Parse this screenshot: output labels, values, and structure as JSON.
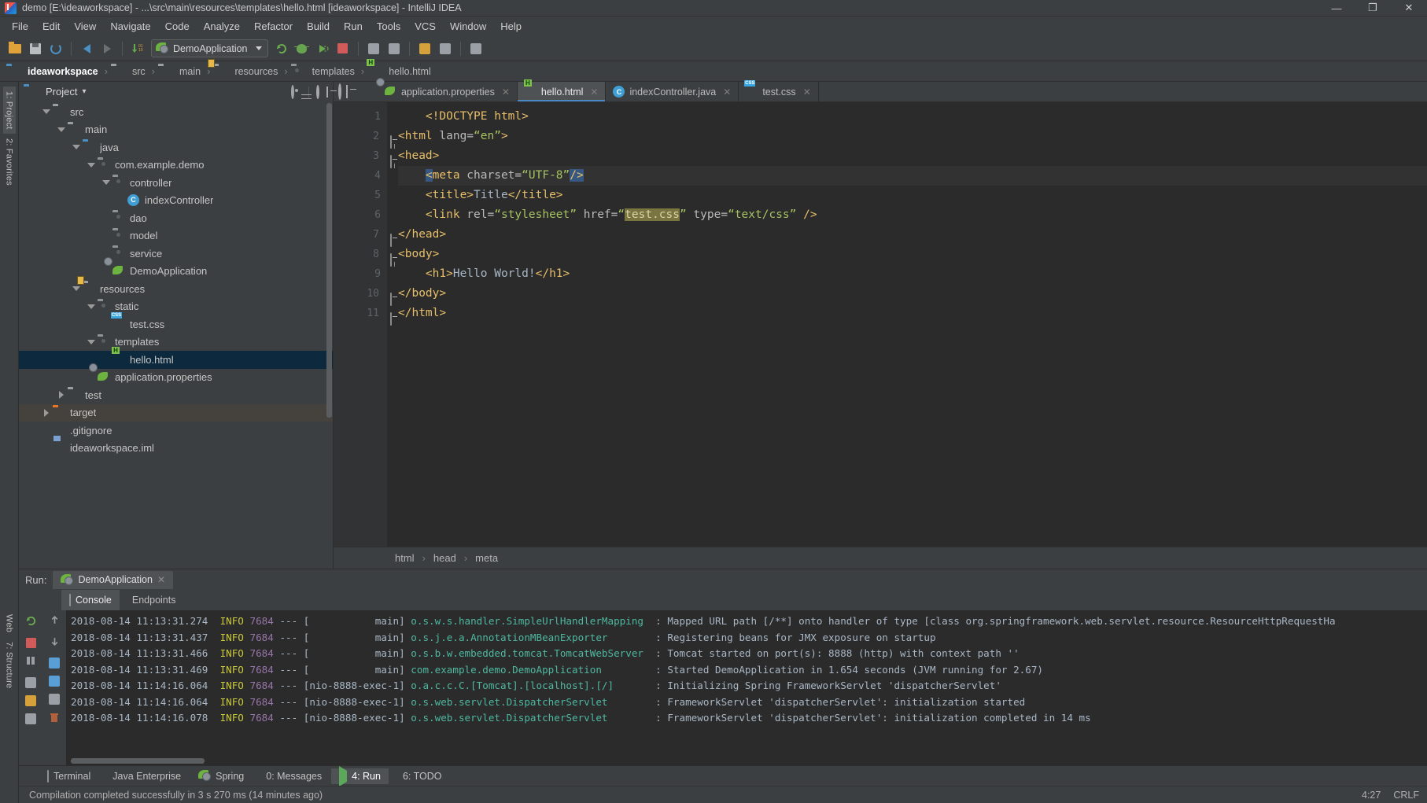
{
  "window": {
    "title": "demo [E:\\ideaworkspace] - ...\\src\\main\\resources\\templates\\hello.html [ideaworkspace] - IntelliJ IDEA",
    "minimize": "—",
    "maximize": "❐",
    "close": "✕"
  },
  "menubar": {
    "items": [
      "File",
      "Edit",
      "View",
      "Navigate",
      "Code",
      "Analyze",
      "Refactor",
      "Build",
      "Run",
      "Tools",
      "VCS",
      "Window",
      "Help"
    ]
  },
  "toolbar": {
    "run_configuration": "DemoApplication",
    "icons": [
      "open-folder-icon",
      "save-all-icon",
      "sync-icon",
      "back-icon",
      "forward-icon",
      "compile-icon",
      "rerun-icon",
      "debug-icon",
      "run-with-coverage-icon",
      "stop-icon",
      "update-icon",
      "commit-icon",
      "settings-icon",
      "project-structure-icon",
      "search-everywhere-icon"
    ]
  },
  "navbar": {
    "crumbs": [
      {
        "label": "ideaworkspace",
        "icon": "module-icon"
      },
      {
        "label": "src",
        "icon": "folder-icon"
      },
      {
        "label": "main",
        "icon": "folder-icon"
      },
      {
        "label": "resources",
        "icon": "resources-folder-icon"
      },
      {
        "label": "templates",
        "icon": "folder-icon"
      },
      {
        "label": "hello.html",
        "icon": "html-file-icon"
      }
    ],
    "separator": "›"
  },
  "left_rail": {
    "tabs": [
      "1: Project",
      "2: Favorites",
      "Web",
      "7: Structure"
    ]
  },
  "project_panel": {
    "title": "Project",
    "caret": "▾",
    "tools": [
      "locate-icon",
      "collapse-all-icon",
      "settings-icon",
      "hide-icon"
    ],
    "tree": [
      {
        "label": "src",
        "depth": 1,
        "arrow": "down",
        "icon": "folder-icon",
        "state": "normal"
      },
      {
        "label": "main",
        "depth": 2,
        "arrow": "down",
        "icon": "folder-icon",
        "state": "normal"
      },
      {
        "label": "java",
        "depth": 3,
        "arrow": "down",
        "icon": "source-folder-icon",
        "state": "normal"
      },
      {
        "label": "com.example.demo",
        "depth": 4,
        "arrow": "down",
        "icon": "package-icon",
        "state": "normal"
      },
      {
        "label": "controller",
        "depth": 5,
        "arrow": "down",
        "icon": "package-icon",
        "state": "normal"
      },
      {
        "label": "indexController",
        "depth": 6,
        "arrow": "none",
        "icon": "java-class-icon",
        "state": "normal"
      },
      {
        "label": "dao",
        "depth": 5,
        "arrow": "none",
        "icon": "package-icon",
        "state": "normal"
      },
      {
        "label": "model",
        "depth": 5,
        "arrow": "none",
        "icon": "package-icon",
        "state": "normal"
      },
      {
        "label": "service",
        "depth": 5,
        "arrow": "none",
        "icon": "package-icon",
        "state": "normal"
      },
      {
        "label": "DemoApplication",
        "depth": 5,
        "arrow": "none",
        "icon": "spring-boot-icon",
        "state": "normal"
      },
      {
        "label": "resources",
        "depth": 3,
        "arrow": "down",
        "icon": "resources-folder-icon",
        "state": "normal"
      },
      {
        "label": "static",
        "depth": 4,
        "arrow": "down",
        "icon": "package-icon",
        "state": "normal"
      },
      {
        "label": "test.css",
        "depth": 5,
        "arrow": "none",
        "icon": "css-file-icon",
        "state": "normal"
      },
      {
        "label": "templates",
        "depth": 4,
        "arrow": "down",
        "icon": "package-icon",
        "state": "normal"
      },
      {
        "label": "hello.html",
        "depth": 5,
        "arrow": "none",
        "icon": "html-file-icon",
        "state": "selected"
      },
      {
        "label": "application.properties",
        "depth": 4,
        "arrow": "none",
        "icon": "spring-boot-icon",
        "state": "normal"
      },
      {
        "label": "test",
        "depth": 2,
        "arrow": "right",
        "icon": "folder-icon",
        "state": "normal"
      },
      {
        "label": "target",
        "depth": 1,
        "arrow": "right",
        "icon": "excluded-folder-icon",
        "state": "muted"
      },
      {
        "label": ".gitignore",
        "depth": 1,
        "arrow": "none",
        "icon": "file-icon",
        "state": "normal"
      },
      {
        "label": "ideaworkspace.iml",
        "depth": 1,
        "arrow": "none",
        "icon": "iml-file-icon",
        "state": "normal"
      }
    ]
  },
  "editor": {
    "tabs": [
      {
        "label": "application.properties",
        "icon": "spring-boot-icon",
        "active": false,
        "close": "✕"
      },
      {
        "label": "hello.html",
        "icon": "html-file-icon",
        "active": true,
        "close": "✕"
      },
      {
        "label": "indexController.java",
        "icon": "java-class-icon",
        "active": false,
        "close": "✕"
      },
      {
        "label": "test.css",
        "icon": "css-file-icon",
        "active": false,
        "close": "✕"
      }
    ],
    "line_numbers": [
      "1",
      "2",
      "3",
      "4",
      "5",
      "6",
      "7",
      "8",
      "9",
      "10",
      "11"
    ],
    "lines": [
      {
        "n": 1,
        "indent": 4,
        "fold": "none",
        "current": false,
        "parts": [
          {
            "t": "<!DOCTYPE html>",
            "c": "dt"
          }
        ]
      },
      {
        "n": 2,
        "indent": 0,
        "fold": "open",
        "current": false,
        "parts": [
          {
            "t": "<html",
            "c": "tg"
          },
          {
            "t": " lang=",
            "c": "at"
          },
          {
            "t": "“en”",
            "c": "st"
          },
          {
            "t": ">",
            "c": "tg"
          }
        ]
      },
      {
        "n": 3,
        "indent": 0,
        "fold": "open",
        "current": false,
        "parts": [
          {
            "t": "<head>",
            "c": "tg"
          }
        ]
      },
      {
        "n": 4,
        "indent": 4,
        "fold": "none",
        "current": true,
        "parts": [
          {
            "t": "<",
            "c": "tg hl-green"
          },
          {
            "t": "meta",
            "c": "tg"
          },
          {
            "t": " charset=",
            "c": "at"
          },
          {
            "t": "“UTF-8”",
            "c": "st"
          },
          {
            "t": "/>",
            "c": "tg hl-green"
          }
        ]
      },
      {
        "n": 5,
        "indent": 4,
        "fold": "none",
        "current": false,
        "parts": [
          {
            "t": "<title>",
            "c": "tg"
          },
          {
            "t": "Title",
            "c": "tx"
          },
          {
            "t": "</title>",
            "c": "tg"
          }
        ]
      },
      {
        "n": 6,
        "indent": 4,
        "fold": "none",
        "current": false,
        "parts": [
          {
            "t": "<link",
            "c": "tg"
          },
          {
            "t": " rel=",
            "c": "at"
          },
          {
            "t": "“stylesheet”",
            "c": "st"
          },
          {
            "t": " href=",
            "c": "at"
          },
          {
            "t": "“",
            "c": "st"
          },
          {
            "t": "test.css",
            "c": "st hl-css"
          },
          {
            "t": "”",
            "c": "st"
          },
          {
            "t": " type=",
            "c": "at"
          },
          {
            "t": "“text/css”",
            "c": "st"
          },
          {
            "t": " />",
            "c": "tg"
          }
        ]
      },
      {
        "n": 7,
        "indent": 0,
        "fold": "close",
        "current": false,
        "parts": [
          {
            "t": "</head>",
            "c": "tg"
          }
        ]
      },
      {
        "n": 8,
        "indent": 0,
        "fold": "open",
        "current": false,
        "parts": [
          {
            "t": "<body>",
            "c": "tg"
          }
        ]
      },
      {
        "n": 9,
        "indent": 4,
        "fold": "none",
        "current": false,
        "parts": [
          {
            "t": "<h1>",
            "c": "tg"
          },
          {
            "t": "Hello World!",
            "c": "tx"
          },
          {
            "t": "</h1>",
            "c": "tg"
          }
        ]
      },
      {
        "n": 10,
        "indent": 0,
        "fold": "close",
        "current": false,
        "parts": [
          {
            "t": "</body>",
            "c": "tg"
          }
        ]
      },
      {
        "n": 11,
        "indent": 0,
        "fold": "close",
        "current": false,
        "parts": [
          {
            "t": "</html>",
            "c": "tg"
          }
        ]
      }
    ],
    "breadcrumb": [
      "html",
      "head",
      "meta"
    ],
    "breadcrumb_sep": "›"
  },
  "run_panel": {
    "label": "Run:",
    "config_tab": "DemoApplication",
    "config_close": "✕",
    "subtabs": [
      {
        "label": "Console",
        "icon": "console-icon",
        "active": true
      },
      {
        "label": "Endpoints",
        "icon": "endpoints-icon",
        "active": false
      }
    ],
    "side_icons_left": [
      "rerun-icon",
      "stop-icon",
      "pause-icon",
      "trace-icon",
      "export-icon",
      "print-icon"
    ],
    "side_icons_right": [
      "up-icon",
      "down-icon",
      "soft-wrap-icon",
      "scroll-end-icon",
      "print-icon",
      "trash-icon"
    ],
    "log": [
      {
        "ts": "2018-08-14 11:13:31.274",
        "level": "INFO",
        "pid": "7684",
        "dash": "---",
        "thread": "[           main]",
        "logger": "o.s.w.s.handler.SimpleUrlHandlerMapping",
        "msg": ": Mapped URL path [/**] onto handler of type [class org.springframework.web.servlet.resource.ResourceHttpRequestHa"
      },
      {
        "ts": "2018-08-14 11:13:31.437",
        "level": "INFO",
        "pid": "7684",
        "dash": "---",
        "thread": "[           main]",
        "logger": "o.s.j.e.a.AnnotationMBeanExporter",
        "msg": ": Registering beans for JMX exposure on startup"
      },
      {
        "ts": "2018-08-14 11:13:31.466",
        "level": "INFO",
        "pid": "7684",
        "dash": "---",
        "thread": "[           main]",
        "logger": "o.s.b.w.embedded.tomcat.TomcatWebServer",
        "msg": ": Tomcat started on port(s): 8888 (http) with context path ''"
      },
      {
        "ts": "2018-08-14 11:13:31.469",
        "level": "INFO",
        "pid": "7684",
        "dash": "---",
        "thread": "[           main]",
        "logger": "com.example.demo.DemoApplication",
        "msg": ": Started DemoApplication in 1.654 seconds (JVM running for 2.67)"
      },
      {
        "ts": "2018-08-14 11:14:16.064",
        "level": "INFO",
        "pid": "7684",
        "dash": "---",
        "thread": "[nio-8888-exec-1]",
        "logger": "o.a.c.c.C.[Tomcat].[localhost].[/]",
        "msg": ": Initializing Spring FrameworkServlet 'dispatcherServlet'"
      },
      {
        "ts": "2018-08-14 11:14:16.064",
        "level": "INFO",
        "pid": "7684",
        "dash": "---",
        "thread": "[nio-8888-exec-1]",
        "logger": "o.s.web.servlet.DispatcherServlet",
        "msg": ": FrameworkServlet 'dispatcherServlet': initialization started"
      },
      {
        "ts": "2018-08-14 11:14:16.078",
        "level": "INFO",
        "pid": "7684",
        "dash": "---",
        "thread": "[nio-8888-exec-1]",
        "logger": "o.s.web.servlet.DispatcherServlet",
        "msg": ": FrameworkServlet 'dispatcherServlet': initialization completed in 14 ms"
      }
    ]
  },
  "bottom_strip": {
    "tools": [
      {
        "label": "Terminal",
        "icon": "terminal-icon",
        "active": false,
        "mnemonic": ""
      },
      {
        "label": "Java Enterprise",
        "icon": "java-enterprise-icon",
        "active": false,
        "mnemonic": ""
      },
      {
        "label": "Spring",
        "icon": "spring-icon",
        "active": false,
        "mnemonic": ""
      },
      {
        "label": "0: Messages",
        "icon": "messages-icon",
        "active": false,
        "mnemonic": "0"
      },
      {
        "label": "4: Run",
        "icon": "run-icon",
        "active": true,
        "mnemonic": "4"
      },
      {
        "label": "6: TODO",
        "icon": "todo-icon",
        "active": false,
        "mnemonic": "6"
      }
    ]
  },
  "statusbar": {
    "message": "Compilation completed successfully in 3 s 270 ms (14 minutes ago)",
    "position": "4:27",
    "line_separator": "CRLF"
  },
  "colors": {
    "accent": "#4a88c7",
    "selection": "#0d293e",
    "background": "#3c3f41",
    "editor_bg": "#2b2b2b",
    "string": "#a5c261",
    "tag": "#e8bf6a"
  }
}
